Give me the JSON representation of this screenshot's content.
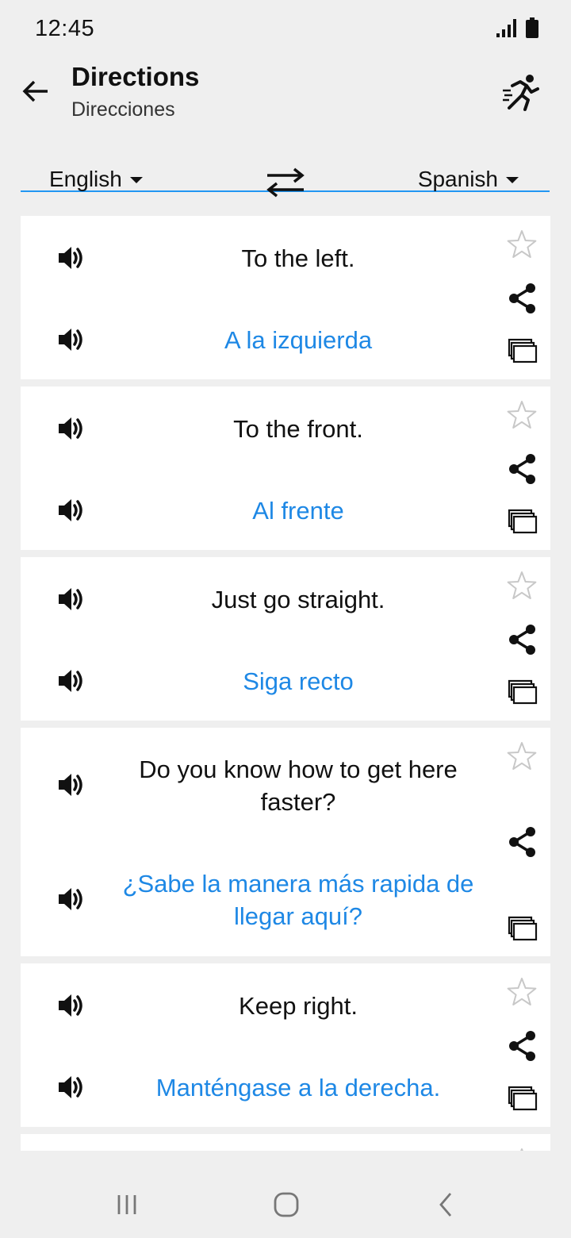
{
  "status_bar": {
    "time": "12:45"
  },
  "app_bar": {
    "title": "Directions",
    "subtitle": "Direcciones"
  },
  "languages": {
    "source": "English",
    "target": "Spanish"
  },
  "colors": {
    "accent": "#2196f3",
    "translation_text": "#1e88e5",
    "background": "#efefef"
  },
  "phrases": [
    {
      "english": "To the left.",
      "spanish": "A la izquierda"
    },
    {
      "english": "To the front.",
      "spanish": "Al frente"
    },
    {
      "english": "Just go straight.",
      "spanish": "Siga recto"
    },
    {
      "english": "Do you know how to get here faster?",
      "spanish": "¿Sabe la manera más rapida de llegar aquí?"
    },
    {
      "english": "Keep right.",
      "spanish": "Manténgase a la derecha."
    }
  ],
  "icons": {
    "back": "arrow-left-icon",
    "quiz": "running-person-icon",
    "swap": "swap-arrows-icon",
    "speaker": "speaker-icon",
    "favorite": "star-outline-icon",
    "share": "share-icon",
    "copy": "copy-icon"
  }
}
